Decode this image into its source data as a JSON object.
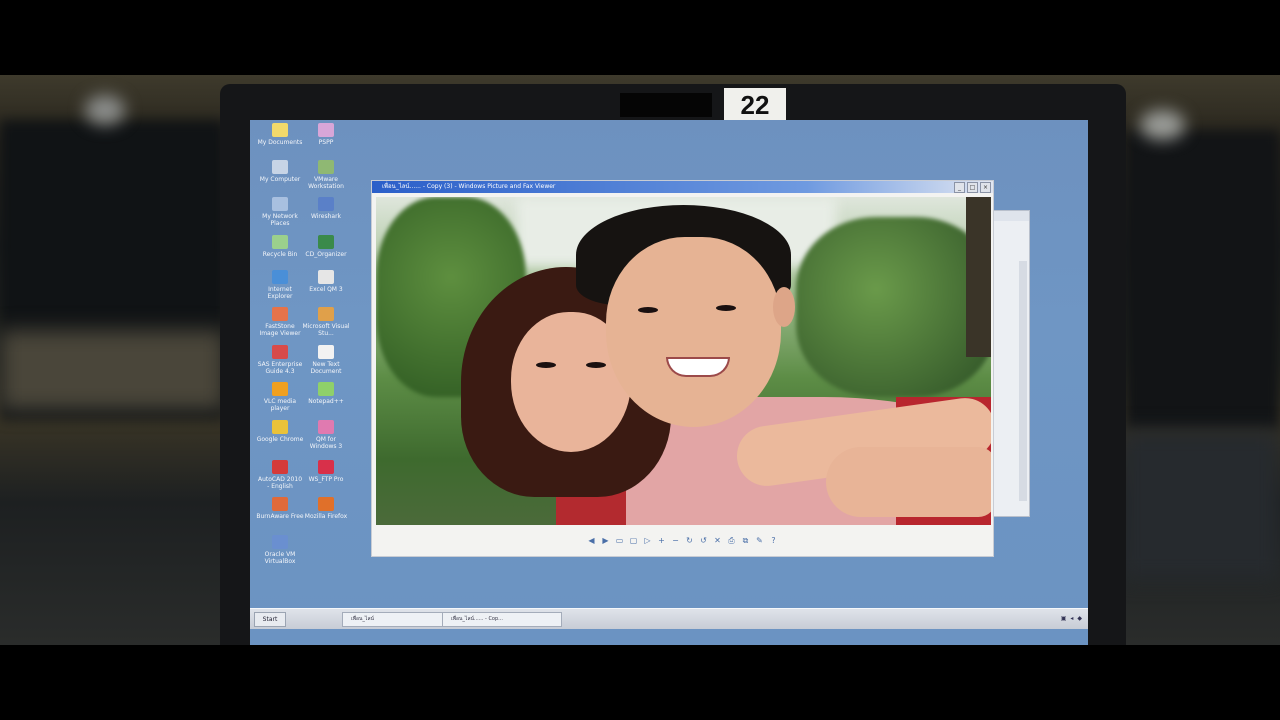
{
  "monitor": {
    "label": "22"
  },
  "desktop": {
    "icons": [
      {
        "label": "My Documents",
        "color": "#f2d96b"
      },
      {
        "label": "PSPP",
        "color": "#d8a6d8"
      },
      {
        "label": "My Computer",
        "color": "#c7d4e6"
      },
      {
        "label": "VMware Workstation",
        "color": "#8fb873"
      },
      {
        "label": "My Network Places",
        "color": "#a8c0e0"
      },
      {
        "label": "Wireshark",
        "color": "#5a80c8"
      },
      {
        "label": "Recycle Bin",
        "color": "#9bd08c"
      },
      {
        "label": "CD_Organizer",
        "color": "#3a8a4a"
      },
      {
        "label": "Internet Explorer",
        "color": "#4a8fd8"
      },
      {
        "label": "Excel QM 3",
        "color": "#e6e6e6"
      },
      {
        "label": "FastStone Image Viewer",
        "color": "#e5734a"
      },
      {
        "label": "Microsoft Visual Stu...",
        "color": "#e0a04a"
      },
      {
        "label": "SAS Enterprise Guide 4.3",
        "color": "#d84a4a"
      },
      {
        "label": "New Text Document",
        "color": "#f2f2f2"
      },
      {
        "label": "VLC media player",
        "color": "#f0a020"
      },
      {
        "label": "Notepad++",
        "color": "#8fd06a"
      },
      {
        "label": "Google Chrome",
        "color": "#e9c23a"
      },
      {
        "label": "QM for Windows 3",
        "color": "#e07ab0"
      },
      {
        "label": "AutoCAD 2010 - English",
        "color": "#d43a3a"
      },
      {
        "label": "WS_FTP Pro",
        "color": "#d8304a"
      },
      {
        "label": "BurnAware Free",
        "color": "#e06a3a"
      },
      {
        "label": "Mozilla Firefox",
        "color": "#e0702a"
      },
      {
        "label": "Oracle VM VirtualBox",
        "color": "#6a8fd0"
      }
    ]
  },
  "viewer": {
    "title": "เพื่อน_ไลน์...... - Copy (3) - Windows Picture and Fax Viewer",
    "controls": {
      "minimize": "_",
      "maximize": "□",
      "close": "×"
    },
    "toolbar_icons": [
      "previous-icon",
      "next-icon",
      "best-fit-icon",
      "actual-size-icon",
      "slideshow-icon",
      "zoom-in-icon",
      "zoom-out-icon",
      "rotate-cw-icon",
      "rotate-ccw-icon",
      "delete-icon",
      "print-icon",
      "copy-to-icon",
      "edit-icon",
      "help-icon"
    ]
  },
  "taskbar": {
    "start_label": "Start",
    "tasks": [
      {
        "label": "เพื่อน_ไลน์"
      },
      {
        "label": "เพื่อน_ไลน์...... - Cop..."
      }
    ]
  }
}
